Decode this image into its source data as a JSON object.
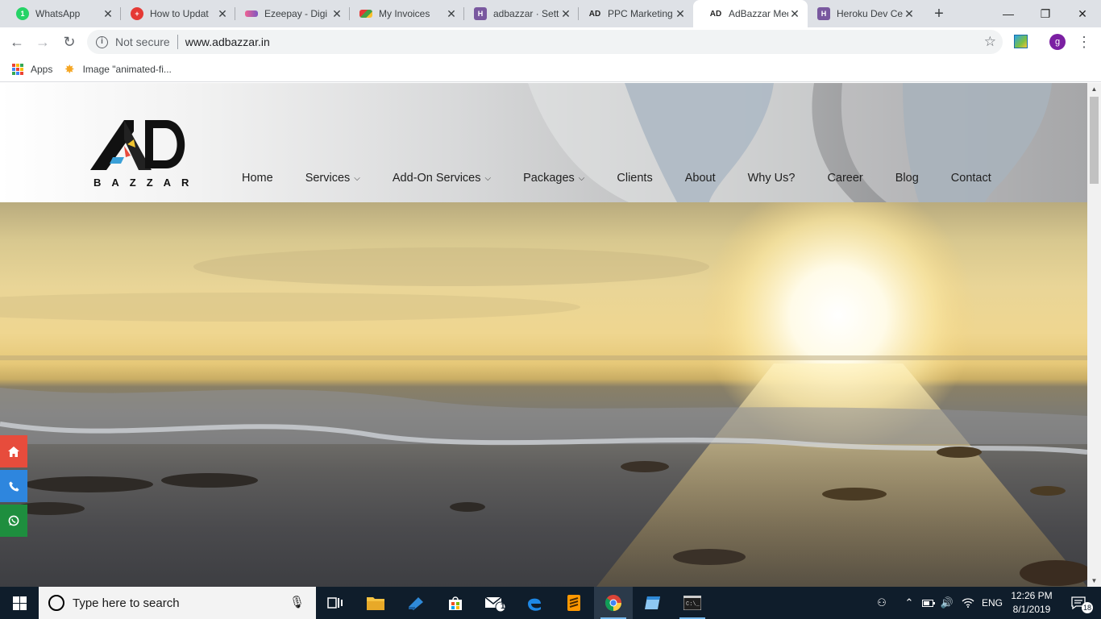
{
  "browser": {
    "tabs": [
      {
        "title": "WhatsApp",
        "favicon": "whatsapp-icon",
        "active": false
      },
      {
        "title": "How to Updat",
        "favicon": "red-plus-icon",
        "active": false
      },
      {
        "title": "Ezeepay - Digi",
        "favicon": "ezeepay-icon",
        "active": false
      },
      {
        "title": "My Invoices",
        "favicon": "invoice-icon",
        "active": false
      },
      {
        "title": "adbazzar · Sett",
        "favicon": "heroku-icon",
        "active": false
      },
      {
        "title": "PPC Marketing",
        "favicon": "ad-logo-icon",
        "active": false
      },
      {
        "title": "AdBazzar Med",
        "favicon": "ad-logo-icon",
        "active": true
      },
      {
        "title": "Heroku Dev Ce",
        "favicon": "heroku-icon",
        "active": false
      }
    ],
    "security_label": "Not secure",
    "url": "www.adbazzar.in",
    "profile_initial": "g",
    "bookmarks": [
      {
        "label": "Apps",
        "icon": "apps-grid-icon"
      },
      {
        "label": "Image \"animated-fi...",
        "icon": "bookmark-star-icon"
      }
    ]
  },
  "site": {
    "logo_text": "AD",
    "logo_subtext": "BAZZAR",
    "nav": [
      {
        "label": "Home",
        "dropdown": false
      },
      {
        "label": "Services",
        "dropdown": true
      },
      {
        "label": "Add-On Services",
        "dropdown": true
      },
      {
        "label": "Packages",
        "dropdown": true
      },
      {
        "label": "Clients",
        "dropdown": false
      },
      {
        "label": "About",
        "dropdown": false
      },
      {
        "label": "Why Us?",
        "dropdown": false
      },
      {
        "label": "Career",
        "dropdown": false
      },
      {
        "label": "Blog",
        "dropdown": false
      },
      {
        "label": "Contact",
        "dropdown": false
      }
    ],
    "floating_buttons": [
      {
        "name": "home-icon",
        "color": "#e74c3c"
      },
      {
        "name": "phone-icon",
        "color": "#2e86de"
      },
      {
        "name": "whatsapp-icon",
        "color": "#1e8e3e"
      }
    ]
  },
  "taskbar": {
    "search_placeholder": "Type here to search",
    "mail_badge": "12",
    "language": "ENG",
    "time": "12:26 PM",
    "date": "8/1/2019",
    "notification_count": "18"
  },
  "colors": {
    "tabstrip": "#dee1e6",
    "taskbar": "#0f1d2b",
    "accent_purple": "#7b1fa2"
  }
}
